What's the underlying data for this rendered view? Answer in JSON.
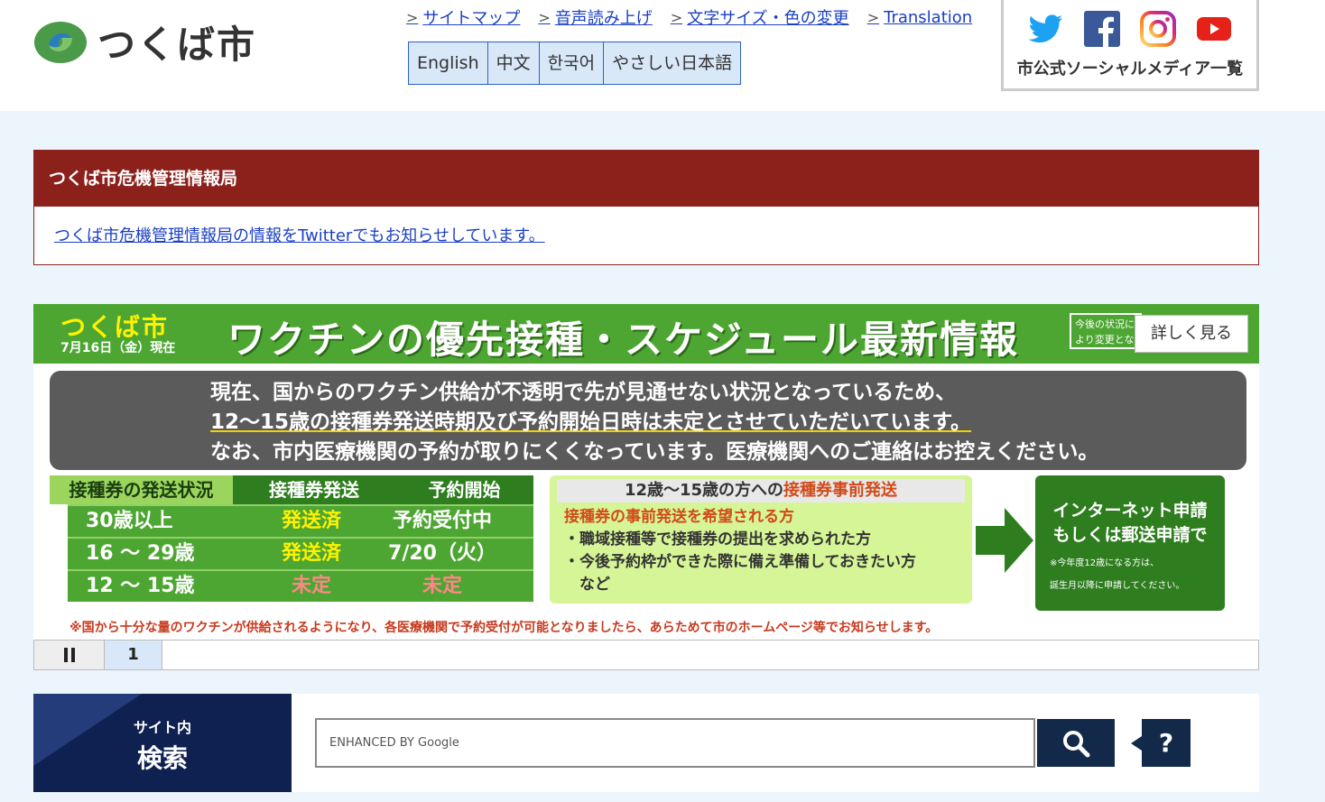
{
  "header": {
    "logo_text": "つくば市",
    "util_links": [
      {
        "label": "サイトマップ"
      },
      {
        "label": "音声読み上げ"
      },
      {
        "label": "文字サイズ・色の変更"
      },
      {
        "label": "Translation"
      }
    ],
    "languages": [
      "English",
      "中文",
      "한국어",
      "やさしい日本語"
    ],
    "social": {
      "icons": [
        "twitter-icon",
        "facebook-icon",
        "instagram-icon",
        "youtube-icon"
      ],
      "label": "市公式ソーシャルメディア一覧"
    }
  },
  "crisis": {
    "title": "つくば市危機管理情報局",
    "link": "つくば市危機管理情報局の情報をTwitterでもお知らせしています。"
  },
  "banner": {
    "city": "つくば市",
    "date": "7月16日（金）現在",
    "title": "ワクチンの優先接種・スケジュール最新情報",
    "small_box": "今後の状況により変更となる場合がございます",
    "more_button": "詳しく見る",
    "notice_lines": [
      "現在、国からのワクチン供給が不透明で先が見通せない状況となっているため、",
      "12〜15歳の接種券発送時期及び予約開始日時は未定とさせていただいています。",
      "なお、市内医療機関の予約が取りにくくなっています。医療機関へのご連絡はお控えください。"
    ],
    "table": {
      "headers": [
        "接種券の発送状況",
        "接種券発送",
        "予約開始"
      ],
      "rows": [
        {
          "age": "30歳以上",
          "sent": "発送済",
          "booking": "予約受付中"
        },
        {
          "age": "16 〜 29歳",
          "sent": "発送済",
          "booking": "7/20（火）"
        },
        {
          "age": "12 〜 15歳",
          "sent": "未定",
          "booking": "未定"
        }
      ]
    },
    "advance": {
      "head_a": "12歳〜15歳の方への",
      "head_b": "接種券事前発送",
      "subhead": "接種券の事前発送を希望される方",
      "items": [
        "・職域接種等で接種券の提出を求められた方",
        "・今後予約枠ができた際に備え準備しておきたい方",
        "　など"
      ]
    },
    "apply": {
      "line1": "インターネット申請",
      "line2": "もしくは郵送申請で",
      "note1": "※今年度12歳になる方は、",
      "note2": "誕生月以降に申請してください。"
    },
    "footnote": "※国から十分な量のワクチンが供給されるようになり、各医療機関で予約受付が可能となりましたら、あらためて市のホームページ等でお知らせします。"
  },
  "slider": {
    "page": "1"
  },
  "search": {
    "label_small": "サイト内",
    "label_big": "検索",
    "placeholder": "ENHANCED BY Google",
    "help": "?"
  }
}
